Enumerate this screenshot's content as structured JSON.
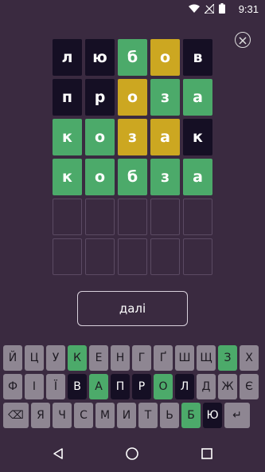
{
  "status": {
    "time": "9:31",
    "icons": [
      "wifi-icon",
      "no-signal-icon",
      "battery-icon"
    ]
  },
  "close_icon": "close-icon",
  "grid": {
    "rows": [
      [
        {
          "letter": "л",
          "state": "absent"
        },
        {
          "letter": "ю",
          "state": "absent"
        },
        {
          "letter": "б",
          "state": "correct"
        },
        {
          "letter": "о",
          "state": "present"
        },
        {
          "letter": "в",
          "state": "absent"
        }
      ],
      [
        {
          "letter": "п",
          "state": "absent"
        },
        {
          "letter": "р",
          "state": "absent"
        },
        {
          "letter": "о",
          "state": "present"
        },
        {
          "letter": "з",
          "state": "correct"
        },
        {
          "letter": "а",
          "state": "correct"
        }
      ],
      [
        {
          "letter": "к",
          "state": "correct"
        },
        {
          "letter": "о",
          "state": "correct"
        },
        {
          "letter": "з",
          "state": "present"
        },
        {
          "letter": "а",
          "state": "present"
        },
        {
          "letter": "к",
          "state": "absent"
        }
      ],
      [
        {
          "letter": "к",
          "state": "correct"
        },
        {
          "letter": "о",
          "state": "correct"
        },
        {
          "letter": "б",
          "state": "correct"
        },
        {
          "letter": "з",
          "state": "correct"
        },
        {
          "letter": "а",
          "state": "correct"
        }
      ],
      [
        {
          "letter": "",
          "state": "empty"
        },
        {
          "letter": "",
          "state": "empty"
        },
        {
          "letter": "",
          "state": "empty"
        },
        {
          "letter": "",
          "state": "empty"
        },
        {
          "letter": "",
          "state": "empty"
        }
      ],
      [
        {
          "letter": "",
          "state": "empty"
        },
        {
          "letter": "",
          "state": "empty"
        },
        {
          "letter": "",
          "state": "empty"
        },
        {
          "letter": "",
          "state": "empty"
        },
        {
          "letter": "",
          "state": "empty"
        }
      ]
    ]
  },
  "next_button": {
    "label": "далі"
  },
  "keyboard": {
    "rows": [
      [
        {
          "k": "Й",
          "s": "default"
        },
        {
          "k": "Ц",
          "s": "default"
        },
        {
          "k": "У",
          "s": "default"
        },
        {
          "k": "К",
          "s": "correct"
        },
        {
          "k": "Е",
          "s": "default"
        },
        {
          "k": "Н",
          "s": "default"
        },
        {
          "k": "Г",
          "s": "default"
        },
        {
          "k": "Ґ",
          "s": "default"
        },
        {
          "k": "Ш",
          "s": "default"
        },
        {
          "k": "Щ",
          "s": "default"
        },
        {
          "k": "З",
          "s": "correct"
        },
        {
          "k": "Х",
          "s": "default"
        }
      ],
      [
        {
          "k": "Ф",
          "s": "default"
        },
        {
          "k": "І",
          "s": "default"
        },
        {
          "k": "Ї",
          "s": "default"
        },
        {
          "k": "В",
          "s": "absent"
        },
        {
          "k": "А",
          "s": "correct"
        },
        {
          "k": "П",
          "s": "absent"
        },
        {
          "k": "Р",
          "s": "absent"
        },
        {
          "k": "О",
          "s": "correct"
        },
        {
          "k": "Л",
          "s": "absent"
        },
        {
          "k": "Д",
          "s": "default"
        },
        {
          "k": "Ж",
          "s": "default"
        },
        {
          "k": "Є",
          "s": "default"
        }
      ],
      [
        {
          "k": "⌫",
          "s": "default",
          "wide": true
        },
        {
          "k": "Я",
          "s": "default"
        },
        {
          "k": "Ч",
          "s": "default"
        },
        {
          "k": "С",
          "s": "default"
        },
        {
          "k": "М",
          "s": "default"
        },
        {
          "k": "И",
          "s": "default"
        },
        {
          "k": "Т",
          "s": "default"
        },
        {
          "k": "Ь",
          "s": "default"
        },
        {
          "k": "Б",
          "s": "correct"
        },
        {
          "k": "Ю",
          "s": "absent"
        },
        {
          "k": "↵",
          "s": "default",
          "wide": true
        }
      ]
    ]
  },
  "navbar": {
    "icons": [
      "back-icon",
      "home-icon",
      "recents-icon"
    ]
  }
}
